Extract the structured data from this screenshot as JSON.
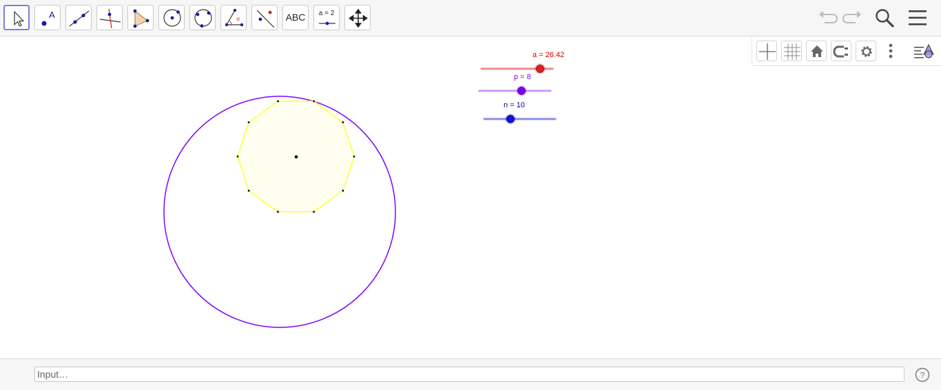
{
  "toolbar": {
    "tools": [
      {
        "id": "move",
        "label": ""
      },
      {
        "id": "point",
        "label": ""
      },
      {
        "id": "line",
        "label": ""
      },
      {
        "id": "perpendicular-line",
        "label": ""
      },
      {
        "id": "polygon",
        "label": ""
      },
      {
        "id": "circle-center-point",
        "label": ""
      },
      {
        "id": "circle-three-points",
        "label": ""
      },
      {
        "id": "angle",
        "label": ""
      },
      {
        "id": "reflect",
        "label": ""
      },
      {
        "id": "text",
        "label": "ABC"
      },
      {
        "id": "slider",
        "label": "a = 2"
      },
      {
        "id": "move-graphics-view",
        "label": ""
      }
    ],
    "right_icons": [
      "undo-icon",
      "redo-icon",
      "search-icon",
      "menu-icon"
    ]
  },
  "sliders": [
    {
      "name": "a",
      "label": "a = 26.42",
      "color": "#cc0000",
      "position": 0.83
    },
    {
      "name": "p",
      "label": "p = 8",
      "color": "#7f00ff",
      "position": 0.6
    },
    {
      "name": "n",
      "label": "n = 10",
      "color": "#0000cc",
      "position": 0.37
    }
  ],
  "style_bar_icons": [
    "axes-icon",
    "grid-icon",
    "home-icon",
    "point-capturing-icon",
    "settings-icon",
    "more-icon",
    "view-toggle-icon"
  ],
  "geometry": {
    "polygon_vertices": 10,
    "circle_color": "#7f00ff",
    "polygon_color": "#ffff33",
    "polygon_fill": "#fffff0"
  },
  "input_bar": {
    "placeholder": "Input…",
    "value": ""
  },
  "help_icon": "help-icon"
}
